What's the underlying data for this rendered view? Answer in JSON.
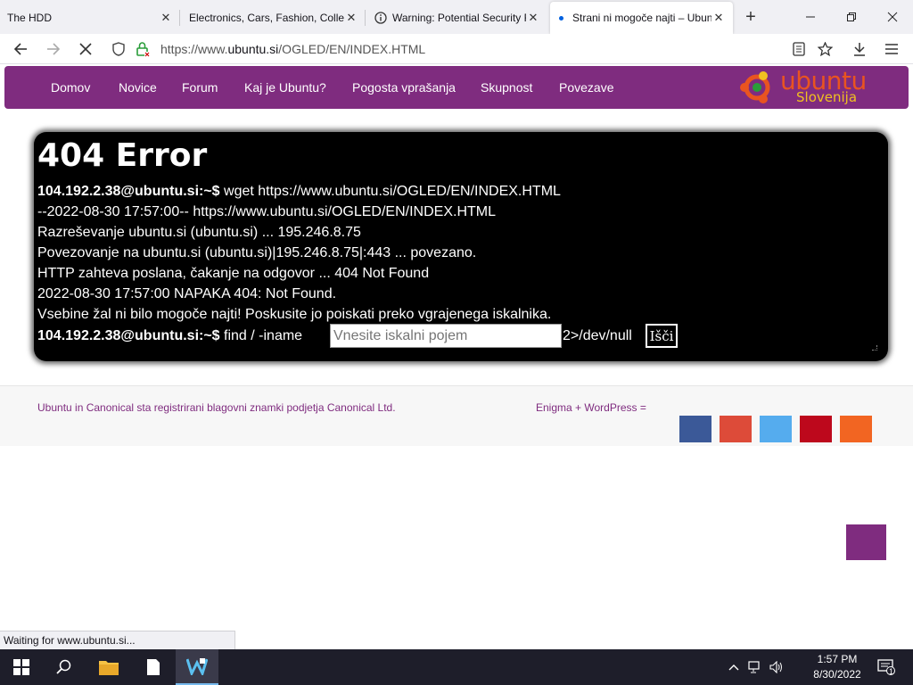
{
  "browser": {
    "tabs": [
      {
        "title": "The HDD"
      },
      {
        "title": "Electronics, Cars, Fashion, Collectibles"
      },
      {
        "title": "Warning: Potential Security Risk"
      },
      {
        "title": "Strani ni mogoče najti – Ubuntu"
      }
    ],
    "new_tab_icon": "plus-icon",
    "url_prefix": "https://www.",
    "url_host": "ubuntu.si",
    "url_path": "/OGLED/EN/INDEX.HTML",
    "status_text": "Waiting for www.ubuntu.si..."
  },
  "site": {
    "menu": [
      "Domov",
      "Novice",
      "Forum",
      "Kaj je Ubuntu?",
      "Pogosta vprašanja",
      "Skupnost",
      "Povezave"
    ],
    "logo_word": "ubuntu",
    "logo_sub": "Slovenija",
    "accent_color": "#7f2c7f",
    "logo_color": "#e95420"
  },
  "terminal": {
    "title": "404 Error",
    "prompt": "104.192.2.38@ubuntu.si:~$",
    "command1": " wget https://www.ubuntu.si/OGLED/EN/INDEX.HTML",
    "lines": [
      "--2022-08-30 17:57:00--  https://www.ubuntu.si/OGLED/EN/INDEX.HTML",
      "Razreševanje ubuntu.si (ubuntu.si) ... 195.246.8.75",
      "Povezovanje na ubuntu.si (ubuntu.si)|195.246.8.75|:443 ... povezano.",
      "HTTP zahteva poslana, čakanje na odgovor ... 404 Not Found",
      "2022-08-30 17:57:00 NAPAKA 404: Not Found.",
      "Vsebine žal ni bilo mogoče najti! Poskusite jo poiskati preko vgrajenega iskalnika."
    ],
    "command2": " find / -iname",
    "search_placeholder": "Vnesite iskalni pojem",
    "suffix": "2>/dev/null",
    "search_button": "Išči"
  },
  "footer": {
    "left": "Ubuntu in Canonical sta registrirani blagovni znamki podjetja Canonical Ltd.",
    "right": "Enigma + WordPress =",
    "social_colors": [
      "#3b5998",
      "#dd4b39",
      "#55acee",
      "#bd081c",
      "#f26522"
    ]
  },
  "taskbar": {
    "time": "1:57 PM",
    "date": "8/30/2022",
    "notifications": "1"
  }
}
